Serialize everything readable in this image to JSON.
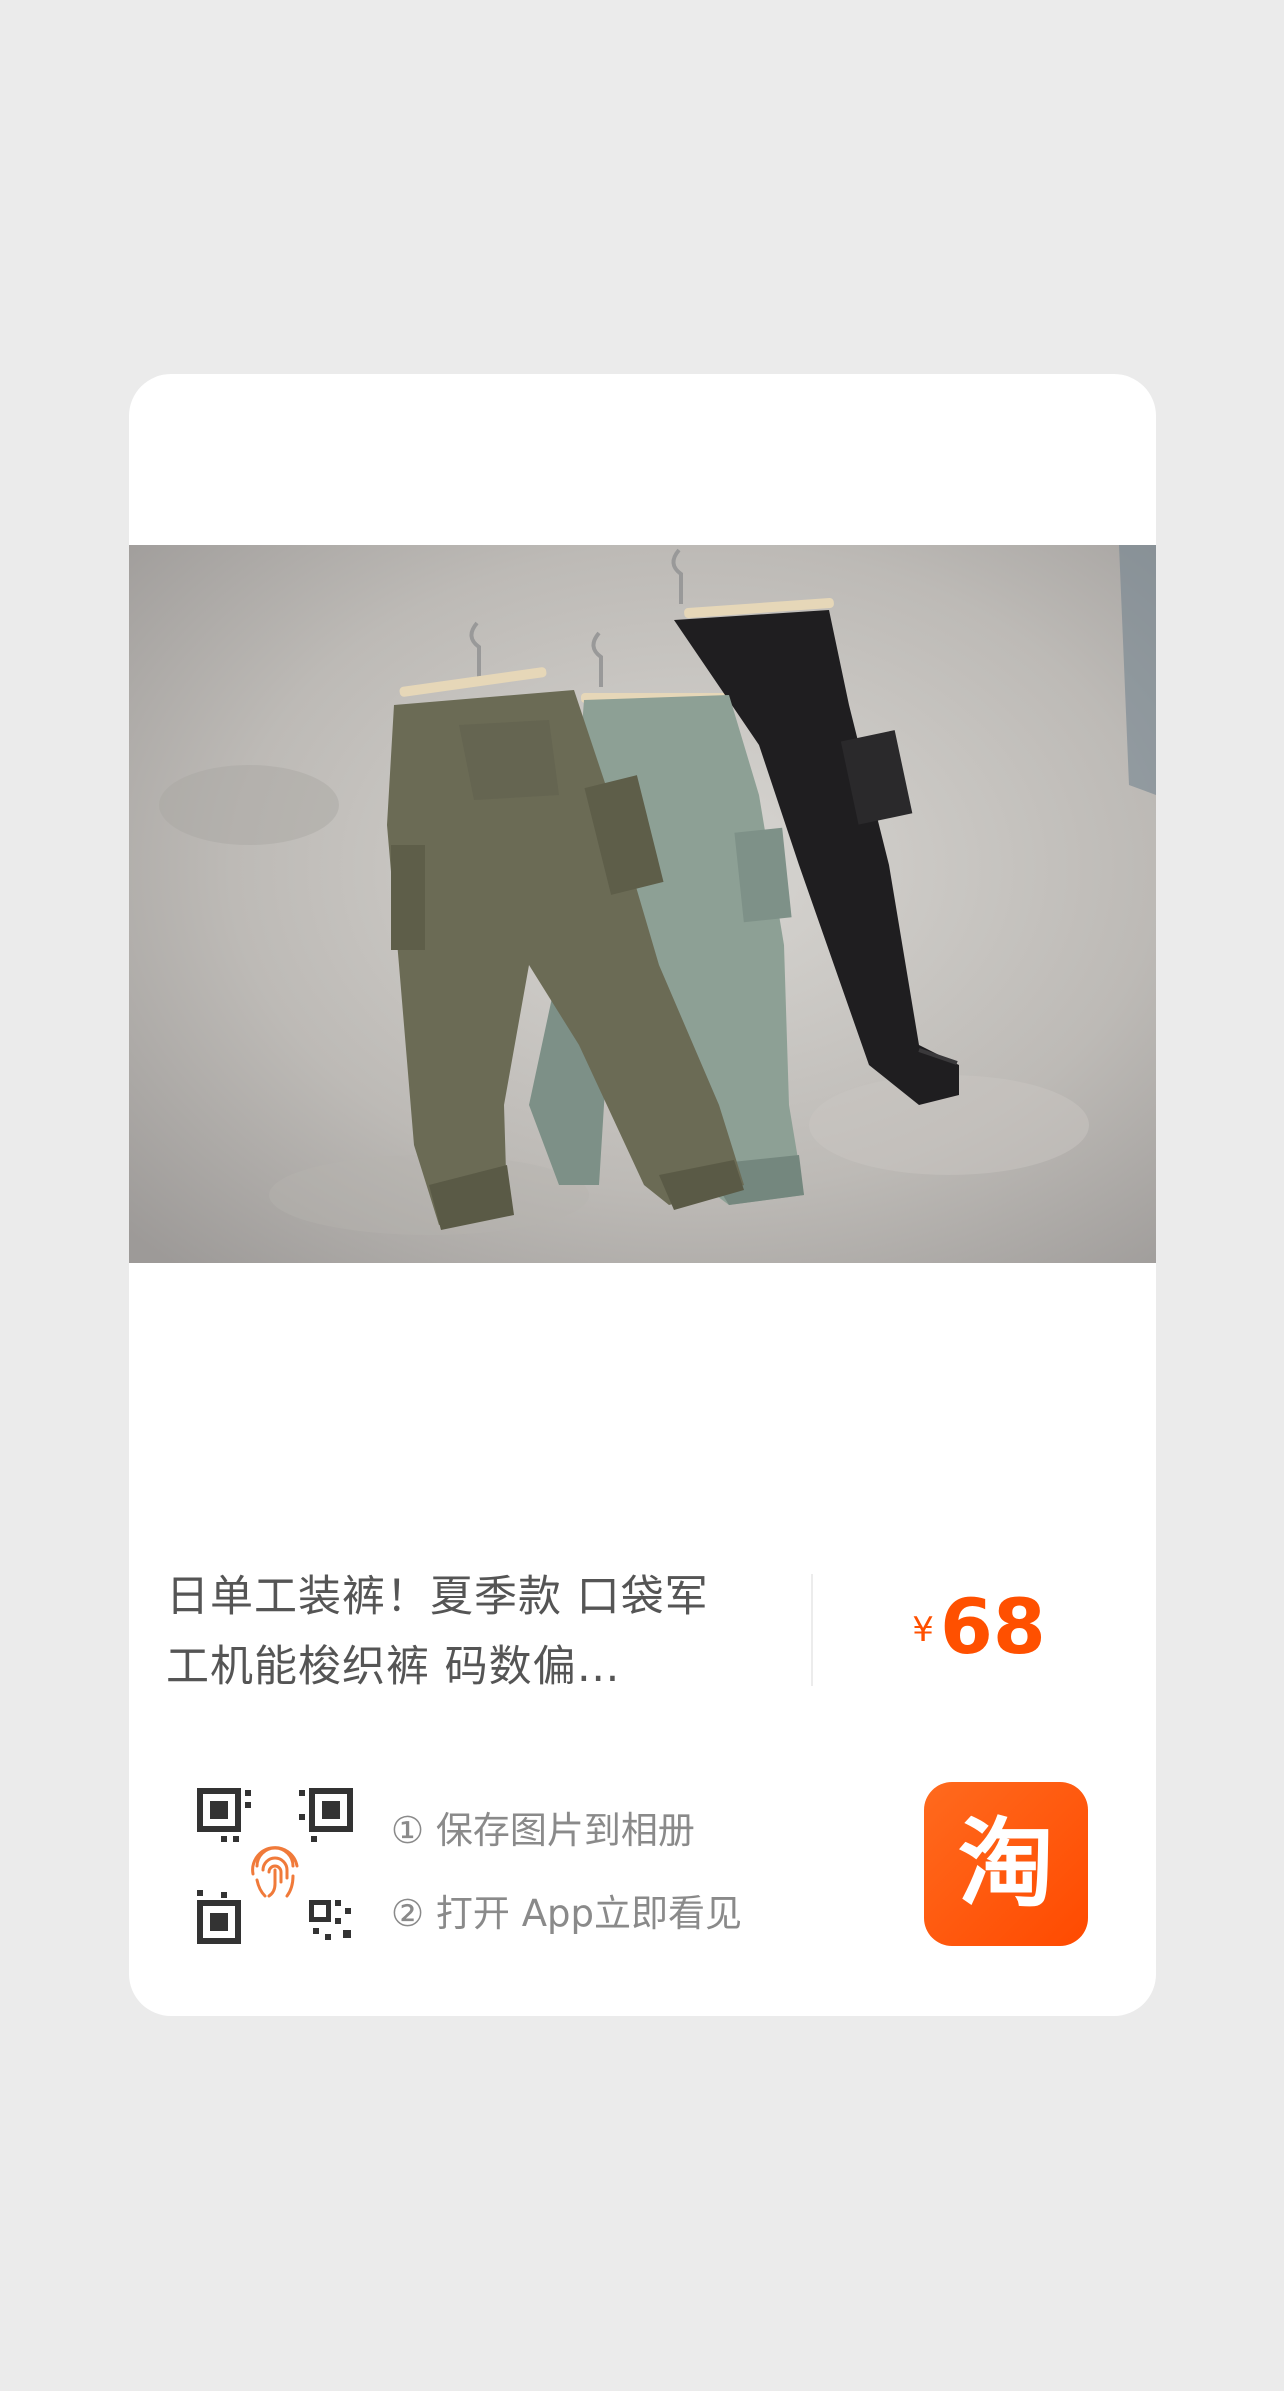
{
  "product": {
    "title": "日单工装裤！夏季款 口袋军工机能梭织裤 码数偏…",
    "image_alt": "cargo pants product photo",
    "price": {
      "currency": "¥",
      "value": "68",
      "color": "#ff5000"
    }
  },
  "share": {
    "qr_icon": "qr-code-fingerprint-icon",
    "steps": [
      "① 保存图片到相册",
      "② 打开 App立即看见"
    ]
  },
  "app": {
    "icon": "taobao-app-icon",
    "glyph": "淘",
    "color": "#ff5000"
  }
}
